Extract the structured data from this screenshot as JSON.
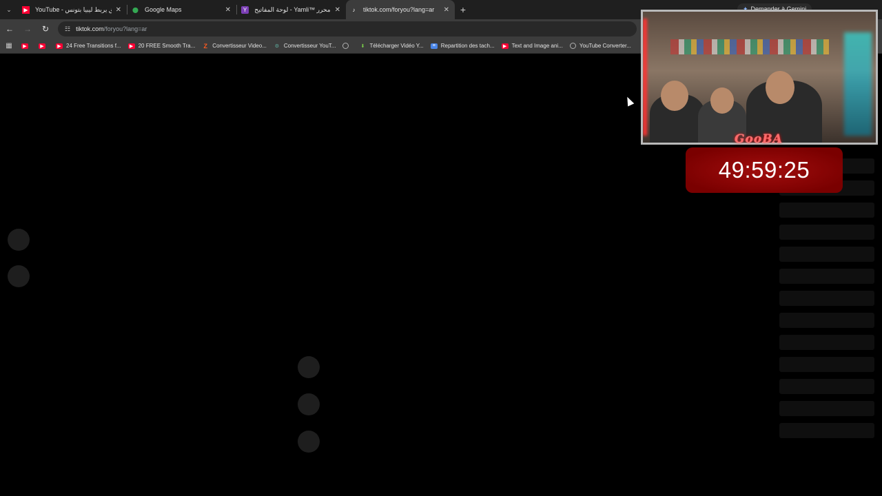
{
  "tabs": [
    {
      "title": "YouTube - نفق يربط ليبيا بتونس",
      "icon": "youtube-icon",
      "active": false
    },
    {
      "title": "Google Maps",
      "icon": "maps-pin-icon",
      "active": false
    },
    {
      "title": "محرر ™Yamli - لوحة المفاتيح العربية",
      "icon": "yamli-icon",
      "active": false
    },
    {
      "title": "tiktok.com/foryou?lang=ar",
      "icon": "tiktok-icon",
      "active": true
    }
  ],
  "gemini_label": "Demander à Gemini",
  "address": {
    "host": "tiktok.com",
    "path": "/foryou?lang=ar"
  },
  "bookmarks": [
    {
      "label": "",
      "icon": "youtube-icon"
    },
    {
      "label": "",
      "icon": "youtube-icon"
    },
    {
      "label": "24 Free Transitions f...",
      "icon": "youtube-icon"
    },
    {
      "label": "20 FREE Smooth Tra...",
      "icon": "youtube-icon"
    },
    {
      "label": "Convertisseur Video...",
      "icon": "z-icon"
    },
    {
      "label": "Convertisseur YouT...",
      "icon": "converter-icon"
    },
    {
      "label": "",
      "icon": "globe-icon"
    },
    {
      "label": "Télécharger Vidéo Y...",
      "icon": "download-icon"
    },
    {
      "label": "Repartition des tach...",
      "icon": "docs-icon"
    },
    {
      "label": "Text and Image ani...",
      "icon": "youtube-icon"
    },
    {
      "label": "YouTube Converter...",
      "icon": "globe-icon"
    }
  ],
  "overlay": {
    "brand": "GooBA",
    "timer": "49:59:25"
  }
}
